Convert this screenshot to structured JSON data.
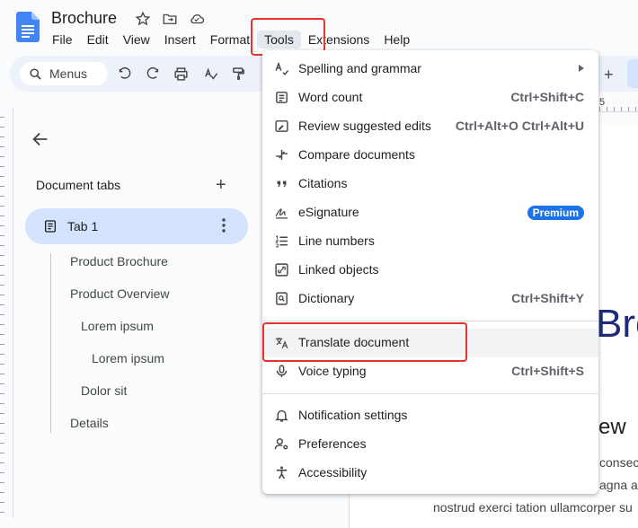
{
  "header": {
    "title": "Brochure",
    "menus": [
      "File",
      "Edit",
      "View",
      "Insert",
      "Format",
      "Tools",
      "Extensions",
      "Help"
    ]
  },
  "toolbar": {
    "search_label": "Menus",
    "ruler_numbers": [
      "5"
    ]
  },
  "sidebar": {
    "tabs_label": "Document tabs",
    "add_symbol": "+",
    "tab1_label": "Tab 1",
    "outline": [
      {
        "label": "Product Brochure",
        "level": 0
      },
      {
        "label": "Product Overview",
        "level": 0
      },
      {
        "label": "Lorem ipsum",
        "level": 1
      },
      {
        "label": "Lorem ipsum",
        "level": 2
      },
      {
        "label": "Dolor sit",
        "level": 1
      },
      {
        "label": "Details",
        "level": 0
      }
    ]
  },
  "page": {
    "heading_fragment": "Bro",
    "subheading_fragment": "ew",
    "lines": [
      "consec",
      "agna a",
      "nostrud exerci tation ullamcorper su"
    ]
  },
  "dropdown": {
    "items": [
      {
        "label": "Spelling and grammar",
        "shortcut": "",
        "submenu": true,
        "icon": "spellcheck-icon"
      },
      {
        "label": "Word count",
        "shortcut": "Ctrl+Shift+C",
        "icon": "word-count-icon"
      },
      {
        "label": "Review suggested edits",
        "shortcut": "Ctrl+Alt+O Ctrl+Alt+U",
        "icon": "review-edits-icon"
      },
      {
        "label": "Compare documents",
        "shortcut": "",
        "icon": "compare-icon"
      },
      {
        "label": "Citations",
        "shortcut": "",
        "icon": "quote-icon"
      },
      {
        "label": "eSignature",
        "shortcut": "",
        "badge": "Premium",
        "icon": "signature-icon"
      },
      {
        "label": "Line numbers",
        "shortcut": "",
        "icon": "line-numbers-icon"
      },
      {
        "label": "Linked objects",
        "shortcut": "",
        "icon": "link-icon"
      },
      {
        "label": "Dictionary",
        "shortcut": "Ctrl+Shift+Y",
        "icon": "dictionary-icon"
      },
      {
        "label": "Translate document",
        "shortcut": "",
        "icon": "translate-icon"
      },
      {
        "label": "Voice typing",
        "shortcut": "Ctrl+Shift+S",
        "icon": "mic-icon"
      },
      {
        "label": "Notification settings",
        "shortcut": "",
        "icon": "bell-icon"
      },
      {
        "label": "Preferences",
        "shortcut": "",
        "icon": "preferences-icon"
      },
      {
        "label": "Accessibility",
        "shortcut": "",
        "icon": "accessibility-icon"
      }
    ]
  },
  "colors": {
    "highlight_border": "#e8322e",
    "premium_badge": "#1a73e8",
    "tab_selected": "#d3e3fd",
    "heading_blue": "#1f2a7a"
  }
}
